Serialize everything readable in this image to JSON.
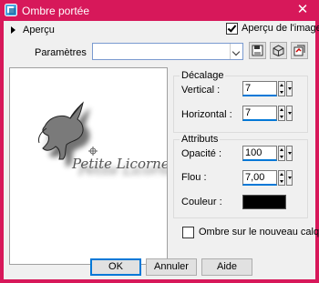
{
  "window": {
    "title": "Ombre portée",
    "close_glyph": "✕"
  },
  "preview": {
    "toggle_label": "Aperçu",
    "apercu_image_label": "Aperçu de l'image",
    "apercu_image_checked": true,
    "watermark": "Petite Licorne Graphisme"
  },
  "params": {
    "label": "Paramètres",
    "value": ""
  },
  "toolbar": {
    "icons": [
      "save-icon",
      "reset-icon",
      "default-settings-icon"
    ]
  },
  "decalage": {
    "title": "Décalage",
    "vertical_label": "Vertical :",
    "vertical_value": "7",
    "horizontal_label": "Horizontal :",
    "horizontal_value": "7"
  },
  "attributs": {
    "title": "Attributs",
    "opacite_label": "Opacité :",
    "opacite_value": "100",
    "flou_label": "Flou :",
    "flou_value": "7,00",
    "couleur_label": "Couleur :",
    "couleur_value": "#000000"
  },
  "ombre_calque": {
    "label": "Ombre sur le nouveau calque",
    "checked": false
  },
  "buttons": {
    "ok": "OK",
    "annuler": "Annuler",
    "aide": "Aide"
  },
  "colors": {
    "titlebar": "#d7185a",
    "accent": "#0078d7"
  }
}
